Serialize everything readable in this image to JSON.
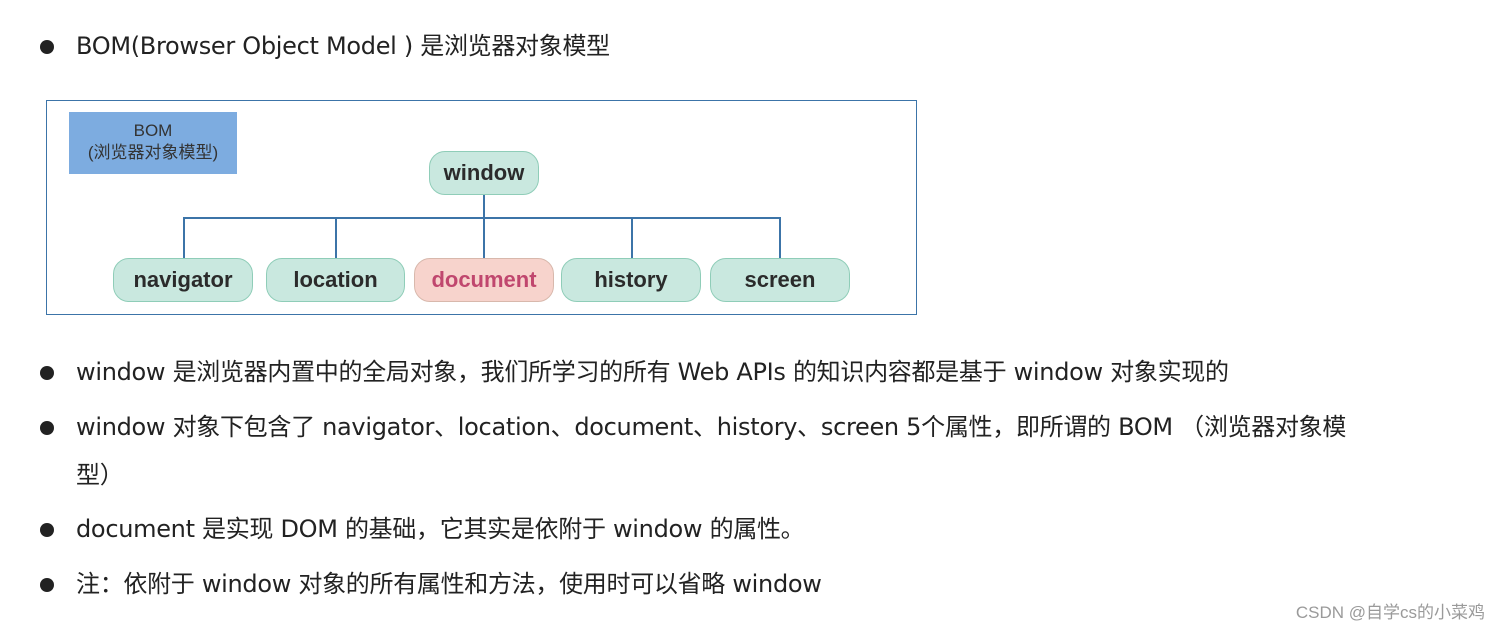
{
  "intro": {
    "text": "BOM(Browser Object Model ) 是浏览器对象模型"
  },
  "diagram": {
    "label_line1": "BOM",
    "label_line2": "(浏览器对象模型)",
    "root": "window",
    "children": [
      "navigator",
      "location",
      "document",
      "history",
      "screen"
    ],
    "highlighted_child": "document",
    "colors": {
      "border": "#3c74a8",
      "label_bg": "#7dace0",
      "node_bg": "#c9e8df",
      "highlight_bg": "#f7d3cc",
      "highlight_text": "#c0476e"
    }
  },
  "bullets": [
    "window 是浏览器内置中的全局对象，我们所学习的所有 Web APIs 的知识内容都是基于 window 对象实现的",
    "window 对象下包含了 navigator、location、document、history、screen 5个属性，即所谓的 BOM （浏览器对象模",
    "型）",
    "document 是实现 DOM 的基础，它其实是依附于 window 的属性。",
    "注：依附于 window 对象的所有属性和方法，使用时可以省略 window"
  ],
  "watermark": "CSDN @自学cs的小菜鸡"
}
